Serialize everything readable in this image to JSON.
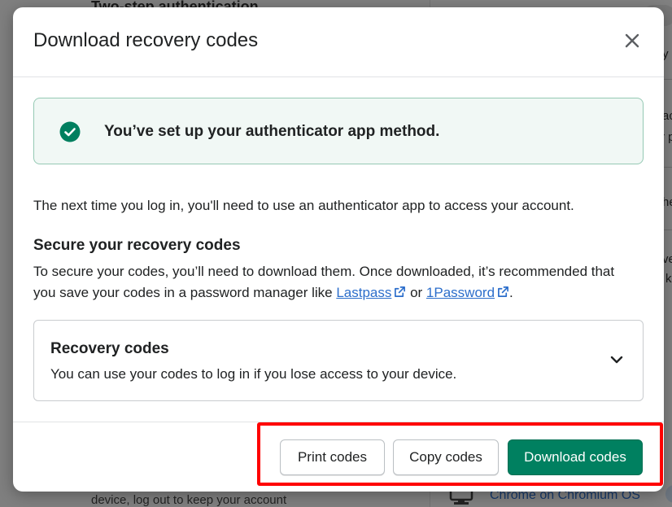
{
  "background": {
    "heading": "Two-step authentication",
    "bottom_text": "device, log out to keep your account",
    "device": "Chrome on Chromium OS",
    "right_fragments": [
      "fy",
      "ac",
      "r p",
      "he",
      "ve",
      "k"
    ]
  },
  "modal": {
    "title": "Download recovery codes",
    "banner": {
      "message": "You’ve set up your authenticator app method."
    },
    "intro": "The next time you log in, you'll need to use an authenticator app to access your account.",
    "secure_section": {
      "title": "Secure your recovery codes",
      "body_line1": "To secure your codes, you’ll need to download them. Once downloaded, it’s recommended that",
      "body_line2_prefix": "you save your codes in a password manager like ",
      "link1": "Lastpass",
      "or_text": " or ",
      "link2": "1Password",
      "end_text": "."
    },
    "recovery_codes": {
      "title": "Recovery codes",
      "description": "You can use your codes to log in if you lose access to your device."
    },
    "footer": {
      "print_label": "Print codes",
      "copy_label": "Copy codes",
      "download_label": "Download codes"
    }
  },
  "colors": {
    "primary": "#008060",
    "link": "#2c6ecb",
    "success_bg": "#f1f8f5",
    "success_border": "#95c9b4",
    "highlight": "#ff0000"
  },
  "icons": {
    "close": "close-icon",
    "success": "check-circle-icon",
    "external": "external-link-icon",
    "chevron": "chevron-down-icon"
  }
}
